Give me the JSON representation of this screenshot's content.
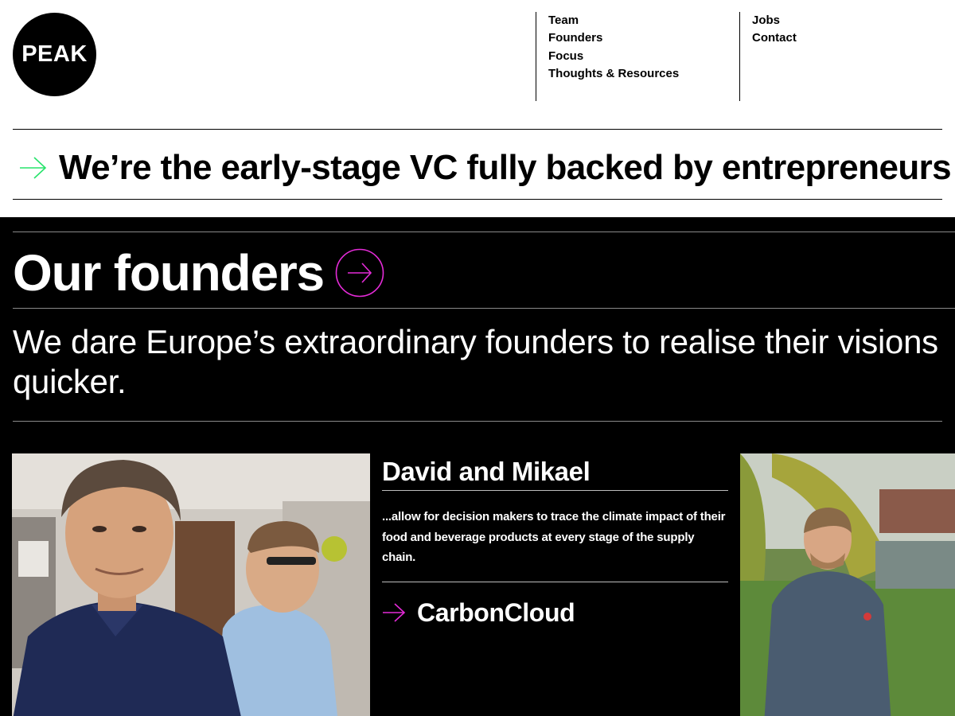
{
  "logo": {
    "text": "PEAK"
  },
  "nav": {
    "col1": [
      "Team",
      "Founders",
      "Focus",
      "Thoughts & Resources"
    ],
    "col2": [
      "Jobs",
      "Contact"
    ]
  },
  "tagline": {
    "icon": "arrow-right-icon",
    "text": "We’re the early-stage VC fully backed by entrepreneurs"
  },
  "founders_section": {
    "title": "Our founders",
    "title_icon": "circle-arrow-right-icon",
    "intro": "We dare Europe’s extraordinary founders to realise their visions quicker.",
    "card": {
      "names": "David and Mikael",
      "description": "...allow for decision makers to trace the climate impact of their food and beverage products at every stage of the supply chain.",
      "company": "CarbonCloud",
      "company_icon": "arrow-right-icon"
    }
  },
  "colors": {
    "accent_green": "#27e36b",
    "accent_magenta": "#e52bd8",
    "dark_bg": "#000000"
  }
}
